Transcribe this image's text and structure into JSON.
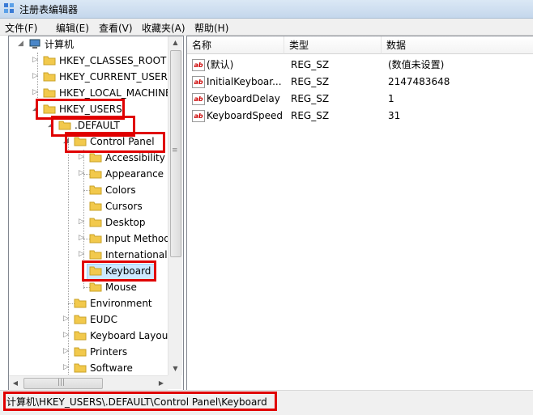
{
  "window": {
    "title": "注册表编辑器"
  },
  "menu": [
    "文件(F)",
    "编辑(E)",
    "查看(V)",
    "收藏夹(A)",
    "帮助(H)"
  ],
  "tree": {
    "root": "计算机",
    "hives": [
      "HKEY_CLASSES_ROOT",
      "HKEY_CURRENT_USER",
      "HKEY_LOCAL_MACHINE",
      "HKEY_USERS"
    ],
    "default": ".DEFAULT",
    "control_panel": "Control Panel",
    "cp_children": [
      "Accessibility",
      "Appearance",
      "Colors",
      "Cursors",
      "Desktop",
      "Input Method",
      "International",
      "Keyboard",
      "Mouse"
    ],
    "default_children": [
      "Environment",
      "EUDC",
      "Keyboard Layout",
      "Printers",
      "Software"
    ]
  },
  "columns": {
    "name": "名称",
    "type": "类型",
    "data": "数据"
  },
  "values": [
    {
      "name": "(默认)",
      "type": "REG_SZ",
      "data": "(数值未设置)"
    },
    {
      "name": "InitialKeyboar...",
      "type": "REG_SZ",
      "data": "2147483648"
    },
    {
      "name": "KeyboardDelay",
      "type": "REG_SZ",
      "data": "1"
    },
    {
      "name": "KeyboardSpeed",
      "type": "REG_SZ",
      "data": "31"
    }
  ],
  "status": {
    "path": "计算机\\HKEY_USERS\\.DEFAULT\\Control Panel\\Keyboard"
  },
  "colors": {
    "highlight": "#e00000",
    "selection": "#cce8ff",
    "folder": "#f2c94c"
  }
}
